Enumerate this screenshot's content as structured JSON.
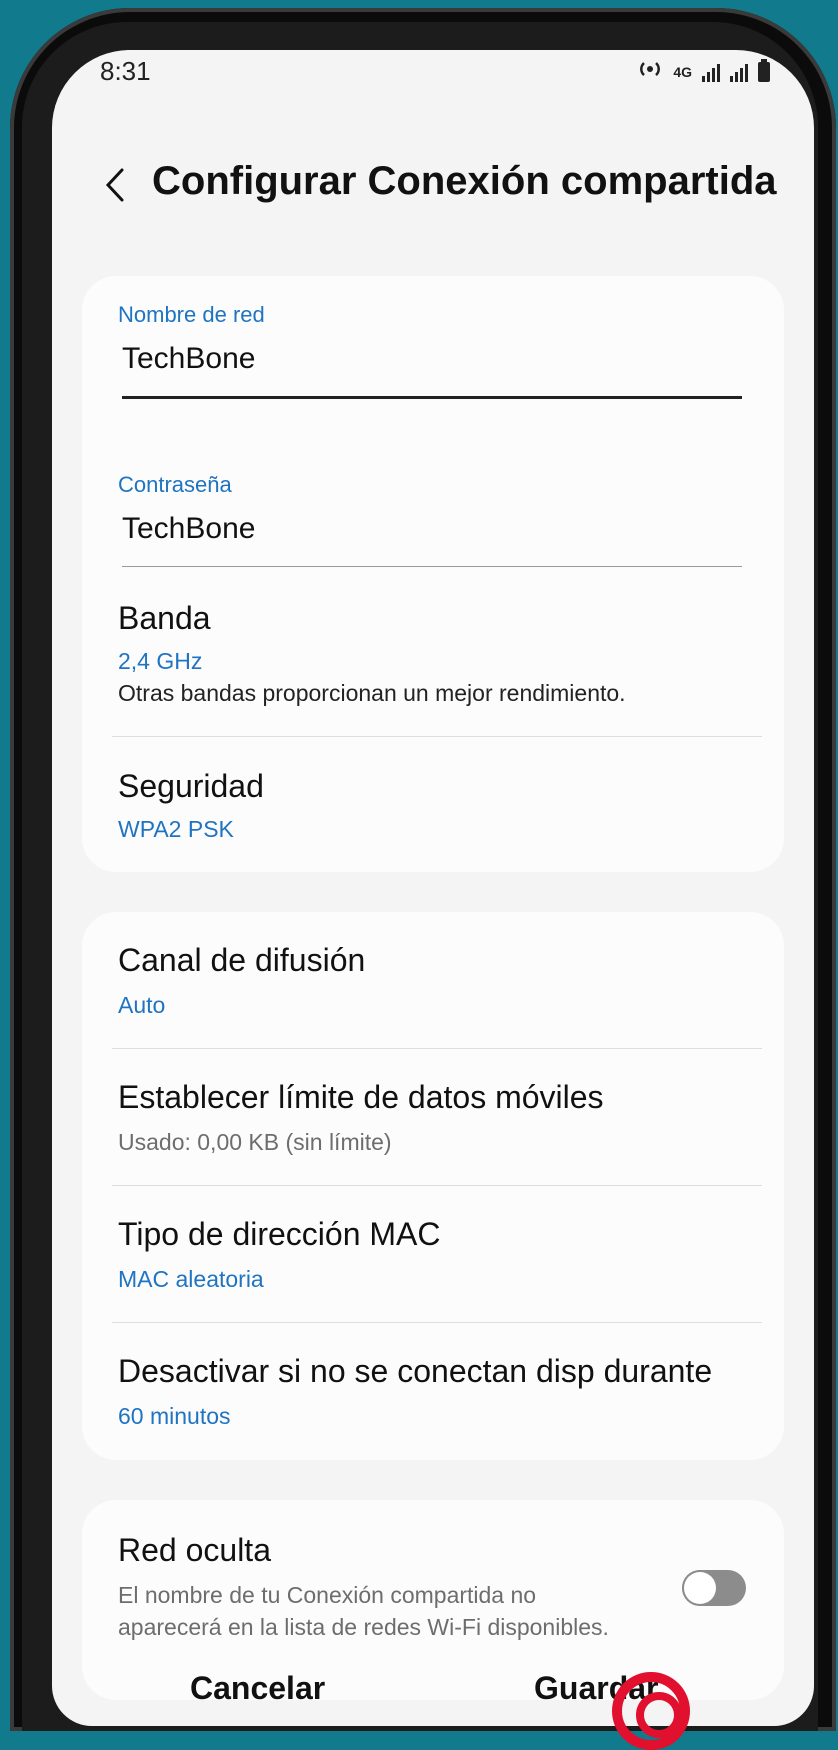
{
  "status_bar": {
    "time": "8:31",
    "network": "4G"
  },
  "header": {
    "back_icon": "chevron-left-icon",
    "title": "Configurar Conexión compartida"
  },
  "network": {
    "name_label": "Nombre de red",
    "name_value": "TechBone",
    "password_label": "Contraseña",
    "password_value": "TechBone",
    "band_title": "Banda",
    "band_value": "2,4 GHz",
    "band_note": "Otras bandas proporcionan un mejor rendimiento.",
    "security_title": "Seguridad",
    "security_value": "WPA2 PSK"
  },
  "advanced": {
    "channel_title": "Canal de difusión",
    "channel_value": "Auto",
    "data_limit_title": "Establecer límite de datos móviles",
    "data_limit_value": "Usado: 0,00 KB (sin límite)",
    "mac_title": "Tipo de dirección MAC",
    "mac_value": "MAC aleatoria",
    "timeout_title": "Desactivar si no se conectan disp durante",
    "timeout_value": "60 minutos"
  },
  "hidden_network": {
    "title": "Red oculta",
    "description_line1": "El nombre de tu Conexión compartida no",
    "description_line2": "aparecerá en la lista de redes Wi-Fi disponibles.",
    "enabled": false
  },
  "actions": {
    "cancel_label": "Cancelar",
    "save_label": "Guardar"
  },
  "colors": {
    "accent": "#1f74c2",
    "background": "#117a8c",
    "marker": "#e0102e"
  }
}
